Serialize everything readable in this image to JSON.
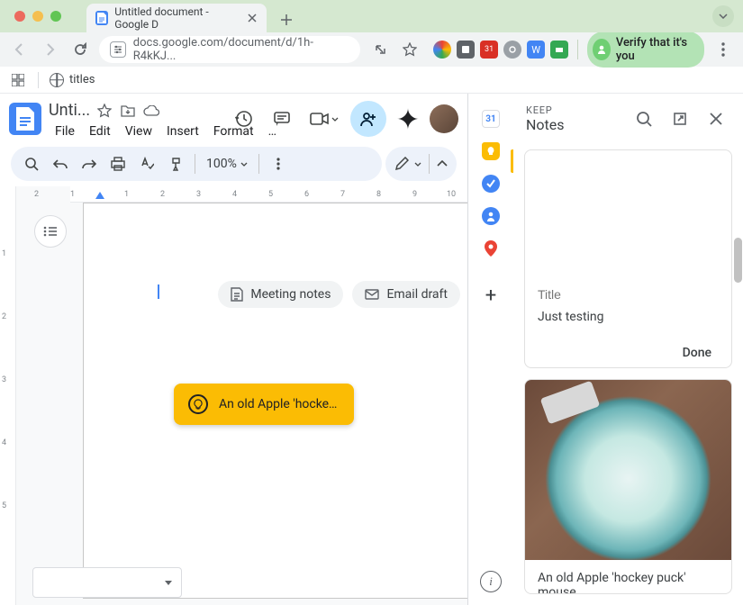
{
  "browser": {
    "tab_title": "Untitled document - Google D",
    "url": "docs.google.com/document/d/1h-R4kKJ...",
    "bookmark_title": "titles",
    "verify_label": "Verify that it's you"
  },
  "docs": {
    "doc_title": "Unti...",
    "menus": [
      "File",
      "Edit",
      "View",
      "Insert",
      "Format",
      "…"
    ],
    "zoom": "100%",
    "suggestions": {
      "meeting": "Meeting notes",
      "email": "Email draft"
    },
    "tooltip": "An old Apple 'hockey …",
    "calendar_day": "31"
  },
  "keep": {
    "suptitle": "KEEP",
    "title": "Notes",
    "compose": {
      "title_placeholder": "Title",
      "body": "Just testing",
      "done_label": "Done"
    },
    "note2": {
      "caption": "An old Apple 'hockey puck' mouse"
    }
  }
}
